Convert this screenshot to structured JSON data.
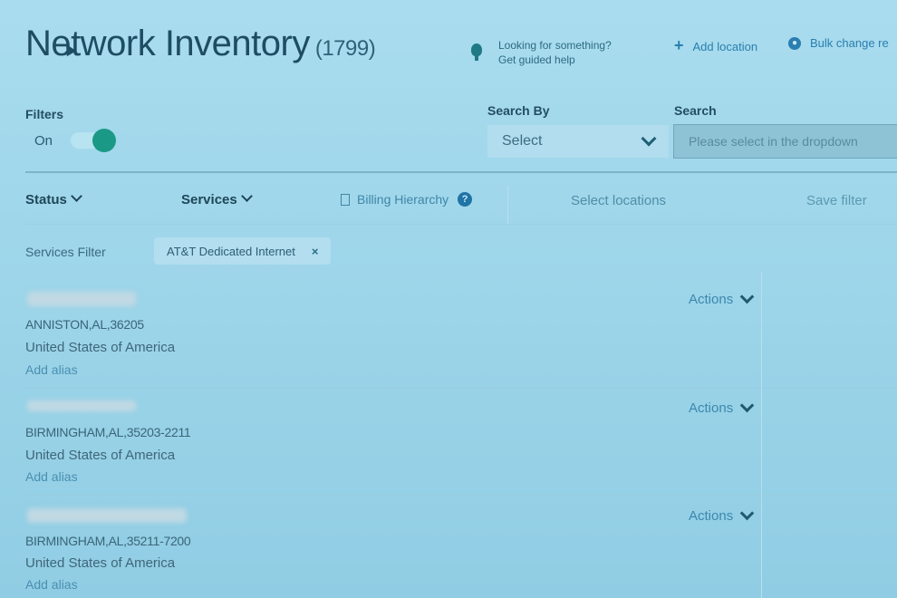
{
  "header": {
    "title": "Network Inventory",
    "count": "(1799)",
    "help_line1": "Looking for something?",
    "help_line2": "Get guided help",
    "add_location": "Add location",
    "bulk_change": "Bulk change re"
  },
  "filters": {
    "label": "Filters",
    "toggle_state": "On",
    "search_by_label": "Search By",
    "search_by_value": "Select",
    "search_label": "Search",
    "search_placeholder": "Please select in the dropdown"
  },
  "filter_bar": {
    "status": "Status",
    "services": "Services",
    "billing": "Billing Hierarchy",
    "select_locations": "Select locations",
    "save_filter": "Save filter"
  },
  "services_filter": {
    "label": "Services Filter",
    "chip": "AT&T Dedicated Internet",
    "chip_close": "×"
  },
  "locations": [
    {
      "address": "ANNISTON,AL,36205",
      "country": "United States of America",
      "alias": "Add alias",
      "actions": "Actions"
    },
    {
      "address": "BIRMINGHAM,AL,35203-2211",
      "country": "United States of America",
      "alias": "Add alias",
      "actions": "Actions"
    },
    {
      "address": "BIRMINGHAM,AL,35211-7200",
      "country": "United States of America",
      "alias": "Add alias",
      "actions": "Actions"
    }
  ]
}
